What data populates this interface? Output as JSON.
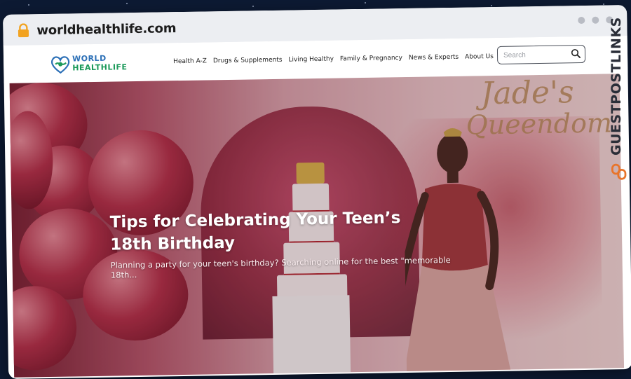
{
  "browser": {
    "url": "worldhealthlife.com"
  },
  "site": {
    "logo": {
      "line1": "WORLD",
      "line2": "HEALTHLIFE"
    },
    "nav": [
      "Health A-Z",
      "Drugs & Supplements",
      "Living Healthy",
      "Family & Pregnancy",
      "News & Experts",
      "About Us"
    ],
    "search": {
      "placeholder": "Search"
    }
  },
  "hero": {
    "title": "Tips for Celebrating Your Teen’s 18th Birthday",
    "excerpt": "Planning a party for your teen's birthday? Searching online for the best \"memorable 18th...",
    "backdrop_sign_line1": "Jade's",
    "backdrop_sign_line2": "Queendom"
  },
  "watermark": {
    "text": "GUESTPOSTLINKS"
  },
  "colors": {
    "accent_orange": "#e8742a",
    "logo_blue": "#2b6fb6",
    "logo_green": "#1c9a5a"
  }
}
